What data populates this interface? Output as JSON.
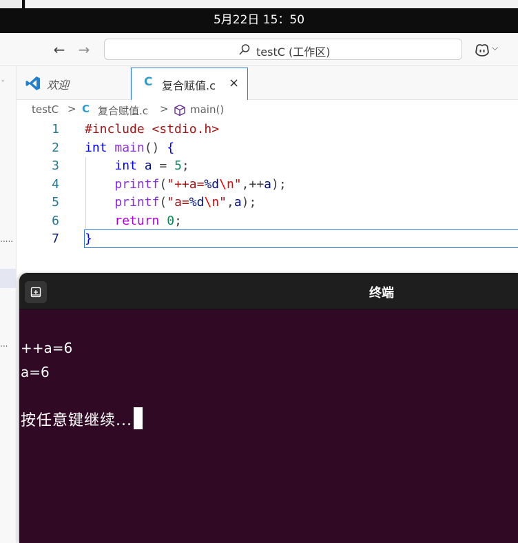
{
  "system": {
    "clock": "5月22日  15：50"
  },
  "titlebar": {
    "command_center": "testC (工作区)",
    "back_icon": "arrow-left-icon",
    "forward_icon": "arrow-right-icon",
    "search_icon": "search-icon",
    "copilot_icon": "copilot-icon"
  },
  "tabs": [
    {
      "label": "欢迎",
      "icon": "vscode-icon",
      "active": false
    },
    {
      "label": "复合赋值.c",
      "icon": "c-icon",
      "active": true,
      "close": "×"
    }
  ],
  "breadcrumb": {
    "folder": "testC",
    "sep": ">",
    "file_icon": "C",
    "file": "复合赋值.c",
    "symbol": "main()"
  },
  "editor": {
    "line_numbers": [
      "1",
      "2",
      "3",
      "4",
      "5",
      "6",
      "7"
    ],
    "lines": [
      [
        [
          "t-pre",
          "#include "
        ],
        [
          "t-str",
          "<stdio.h>"
        ]
      ],
      [
        [
          "t-type",
          "int "
        ],
        [
          "t-fn2",
          "main"
        ],
        [
          "t-punc",
          "() "
        ],
        [
          "t-type",
          "{"
        ]
      ],
      [
        [
          "t-punc",
          "    "
        ],
        [
          "t-type",
          "int "
        ],
        [
          "t-var",
          "a"
        ],
        [
          "t-punc",
          " = "
        ],
        [
          "t-num",
          "5"
        ],
        [
          "t-punc",
          ";"
        ]
      ],
      [
        [
          "t-punc",
          "    "
        ],
        [
          "t-fn2",
          "printf"
        ],
        [
          "t-punc",
          "("
        ],
        [
          "t-str",
          "\"++a="
        ],
        [
          "t-fmt",
          "%d"
        ],
        [
          "t-esc",
          "\\n"
        ],
        [
          "t-str",
          "\""
        ],
        [
          "t-punc",
          ",++"
        ],
        [
          "t-var",
          "a"
        ],
        [
          "t-punc",
          ");"
        ]
      ],
      [
        [
          "t-punc",
          "    "
        ],
        [
          "t-fn2",
          "printf"
        ],
        [
          "t-punc",
          "("
        ],
        [
          "t-str",
          "\"a="
        ],
        [
          "t-fmt",
          "%d"
        ],
        [
          "t-esc",
          "\\n"
        ],
        [
          "t-str",
          "\""
        ],
        [
          "t-punc",
          ","
        ],
        [
          "t-var",
          "a"
        ],
        [
          "t-punc",
          ");"
        ]
      ],
      [
        [
          "t-punc",
          "    "
        ],
        [
          "t-ret",
          "return "
        ],
        [
          "t-num",
          "0"
        ],
        [
          "t-punc",
          ";"
        ]
      ],
      [
        [
          "t-type",
          "}"
        ]
      ]
    ]
  },
  "terminal": {
    "title": "终端",
    "new_tab_icon": "new-tab-icon",
    "output": [
      "++a=6",
      "a=6"
    ],
    "prompt": "按任意键继续..."
  },
  "colors": {
    "terminal_bg": "#300a24",
    "accent": "#2e7dd1"
  }
}
